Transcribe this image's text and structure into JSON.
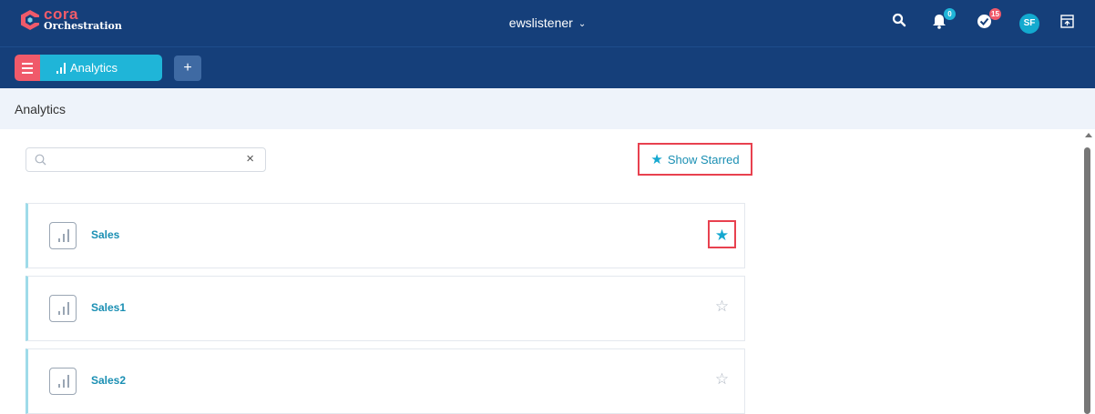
{
  "header": {
    "logo": {
      "line1": "cora",
      "line2": "Orchestration"
    },
    "workspace": "ewslistener",
    "notifications_count": "0",
    "tasks_count": "15",
    "avatar_initials": "SF"
  },
  "tabs": {
    "active_label": "Analytics",
    "add_label": "+"
  },
  "page": {
    "title": "Analytics"
  },
  "search": {
    "value": "",
    "placeholder": ""
  },
  "toolbar": {
    "show_starred_label": "Show Starred"
  },
  "reports": [
    {
      "name": "Sales",
      "starred": true
    },
    {
      "name": "Sales1",
      "starred": false
    },
    {
      "name": "Sales2",
      "starred": false
    }
  ],
  "colors": {
    "header_bg": "#153f7a",
    "accent": "#1fb5d8",
    "brand_red": "#f05a6a",
    "link": "#1a8fb3",
    "highlight_border": "#e8414f"
  },
  "icons": {
    "logo": "cora-logo-icon",
    "search": "search-icon",
    "notifications": "bell-icon",
    "tasks": "check-badge-icon",
    "layout": "layout-toggle-icon",
    "menu": "hamburger-menu-icon",
    "analytics": "bar-chart-icon",
    "star": "star-icon"
  }
}
